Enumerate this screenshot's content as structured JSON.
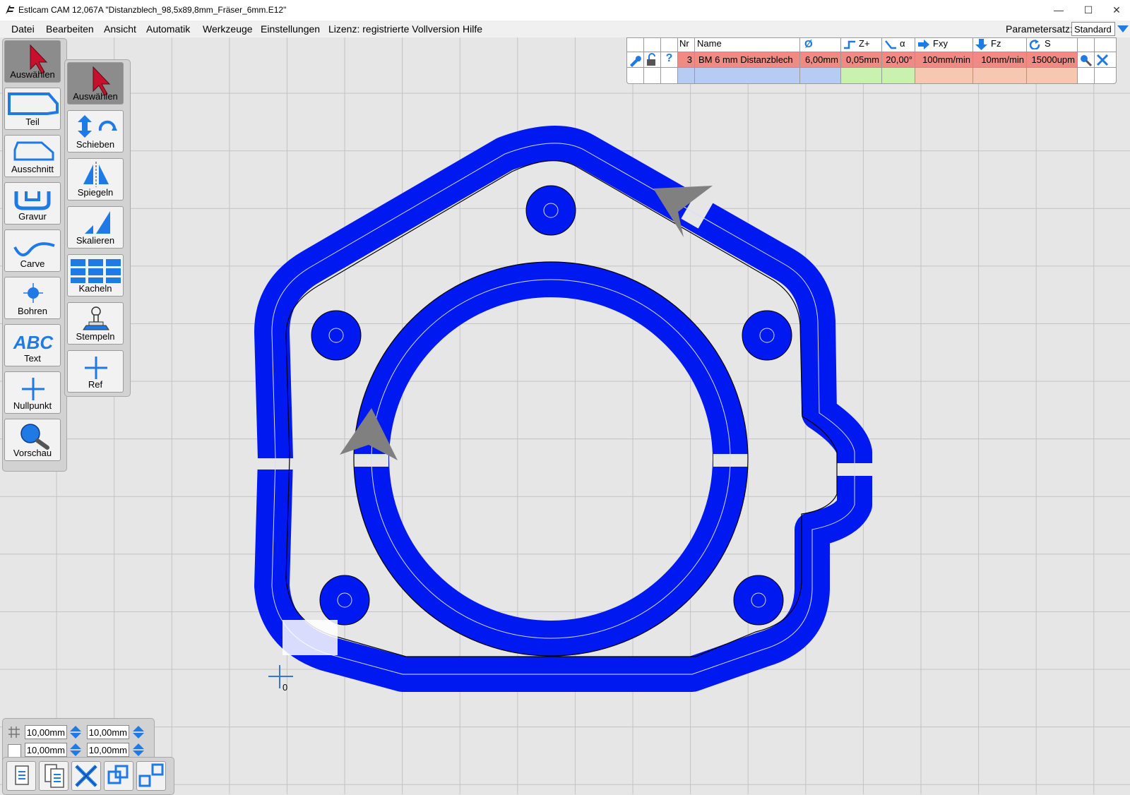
{
  "window": {
    "title": "Estlcam CAM 12,067A \"Distanzblech_98,5x89,8mm_Fräser_6mm.E12\"",
    "minimize": "—",
    "maximize": "☐",
    "close": "✕"
  },
  "menu": {
    "items": [
      "Datei",
      "Bearbeiten",
      "Ansicht",
      "Automatik",
      "Werkzeuge",
      "Einstellungen",
      "Lizenz: registrierte Vollversion",
      "Hilfe"
    ],
    "parameter_label": "Parametersatz:",
    "parameter_value": "Standard"
  },
  "left_tools": {
    "buttons": [
      {
        "label": "Auswählen",
        "icon": "cursor-arrow-icon",
        "active": true
      },
      {
        "label": "Teil",
        "icon": "part-outline-icon"
      },
      {
        "label": "Ausschnitt",
        "icon": "cutout-outline-icon"
      },
      {
        "label": "Gravur",
        "icon": "engrave-icon"
      },
      {
        "label": "Carve",
        "icon": "carve-wave-icon"
      },
      {
        "label": "Bohren",
        "icon": "drill-target-icon"
      },
      {
        "label": "Text",
        "icon": "abc-text-icon",
        "glyph": "ABC"
      },
      {
        "label": "Nullpunkt",
        "icon": "origin-cross-icon"
      },
      {
        "label": "Vorschau",
        "icon": "magnifier-icon"
      }
    ]
  },
  "edit_tools": {
    "buttons": [
      {
        "label": "Auswählen",
        "icon": "cursor-arrow-icon",
        "active": true
      },
      {
        "label": "Schieben",
        "icon": "move-rotate-icon"
      },
      {
        "label": "Spiegeln",
        "icon": "mirror-icon"
      },
      {
        "label": "Skalieren",
        "icon": "scale-icon"
      },
      {
        "label": "Kacheln",
        "icon": "tiles-grid-icon"
      },
      {
        "label": "Stempeln",
        "icon": "stamp-icon"
      },
      {
        "label": "Ref",
        "icon": "reference-cross-icon"
      }
    ]
  },
  "tool_table": {
    "headers": {
      "nr": "Nr",
      "name": "Name",
      "diameter_icon": "Ø",
      "zplus": "Z+",
      "alpha": "α",
      "fxy": "Fxy",
      "fz": "Fz",
      "s": "S"
    },
    "row_icons": [
      "wrench-icon",
      "lock-icon",
      "help-icon"
    ],
    "row": {
      "nr": "3",
      "name": "BM 6 mm Distanzblech",
      "diameter": "6,00mm",
      "zplus": "0,05mm",
      "alpha": "20,00°",
      "fxy": "100mm/min",
      "fz": "10mm/min",
      "s": "15000upm"
    },
    "row_action_icons": [
      "search-icon",
      "delete-x-icon"
    ],
    "colors": {
      "row_red": "#f08a82",
      "empty_blue": "#b7ccf3",
      "empty_green": "#c9f2b0",
      "empty_salmon": "#f6c8b1"
    }
  },
  "canvas": {
    "origin_label": "0",
    "toolpath_color": "#0019f0",
    "grid_color": "#c3c3c3",
    "background": "#e6e6e6"
  },
  "bottom_panel": {
    "grid_icon": "grid-hash-icon",
    "fields": {
      "grid_x": "10,00mm",
      "grid_y": "10,00mm",
      "size_x": "10,00mm",
      "size_y": "10,00mm"
    },
    "buttons": [
      "copy-icon",
      "paste-icon",
      "delete-x-icon",
      "combine-icon",
      "separate-icon"
    ]
  }
}
